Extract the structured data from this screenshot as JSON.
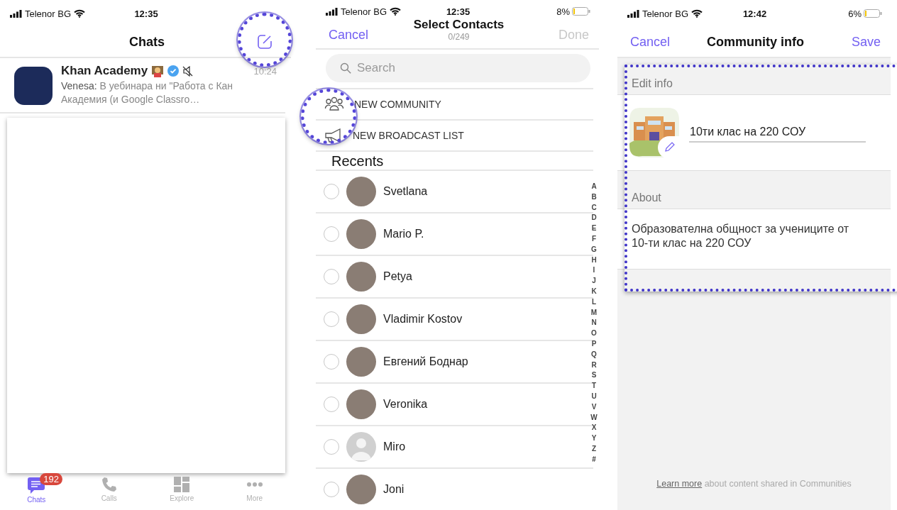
{
  "chats_screen": {
    "status_bar": {
      "carrier": "Telenor BG",
      "time": "12:35"
    },
    "title": "Chats",
    "chats": [
      {
        "name": "Khan Academy",
        "verified": true,
        "muted": true,
        "time": "10:24",
        "preview": "**Venesa:** В уебинара ни \"Работа с Кан Академия (и Google Classro…"
      }
    ],
    "tabs": [
      {
        "label": "Chats",
        "kind": "chats",
        "selected": true,
        "badge": "192"
      },
      {
        "label": "Calls",
        "kind": "calls",
        "selected": false
      },
      {
        "label": "Explore",
        "kind": "explore",
        "selected": false
      },
      {
        "label": "More",
        "kind": "more",
        "selected": false
      }
    ]
  },
  "select_contacts_screen": {
    "status_bar": {
      "carrier": "Telenor BG",
      "time": "12:35",
      "battery": "8%"
    },
    "cancel": "Cancel",
    "title": "Select Contacts",
    "subtitle": "0/249",
    "done": {
      "label": "Done",
      "disabled": true
    },
    "search": {
      "placeholder": "Search"
    },
    "actions": [
      {
        "kind": "community",
        "label": "NEW COMMUNITY"
      },
      {
        "kind": "broadcast",
        "label": "NEW BROADCAST LIST"
      }
    ],
    "section_title": "Recents",
    "contacts": [
      {
        "name": "Svetlana",
        "kind": "photo",
        "selected": false
      },
      {
        "name": "Mario P.",
        "kind": "photo",
        "selected": false
      },
      {
        "name": "Petya",
        "kind": "photo",
        "selected": false
      },
      {
        "name": "Vladimir Kostov",
        "kind": "photo",
        "selected": false
      },
      {
        "name": "Евгений Боднар",
        "kind": "photo",
        "selected": false
      },
      {
        "name": "Veronika",
        "kind": "photo",
        "selected": false
      },
      {
        "name": "Miro",
        "kind": "default",
        "selected": false
      },
      {
        "name": "Joni",
        "kind": "photo",
        "selected": false
      }
    ],
    "index_letters": [
      "A",
      "B",
      "C",
      "D",
      "E",
      "F",
      "G",
      "H",
      "I",
      "J",
      "K",
      "L",
      "M",
      "N",
      "O",
      "P",
      "Q",
      "R",
      "S",
      "T",
      "U",
      "V",
      "W",
      "X",
      "Y",
      "Z",
      "#"
    ]
  },
  "community_info_screen": {
    "status_bar": {
      "carrier": "Telenor BG",
      "time": "12:42",
      "battery": "6%"
    },
    "cancel": "Cancel",
    "title": "Community info",
    "save": {
      "label": "Save",
      "disabled": false
    },
    "edit_info_header": "Edit info",
    "name_value": "10ти клас на 220 СОУ",
    "about_header": "About",
    "about_text": "Образователна общност за учениците от 10-ти клас на 220 СОУ",
    "footer": {
      "link": "Learn more",
      "text": "about content shared in Communities"
    }
  }
}
